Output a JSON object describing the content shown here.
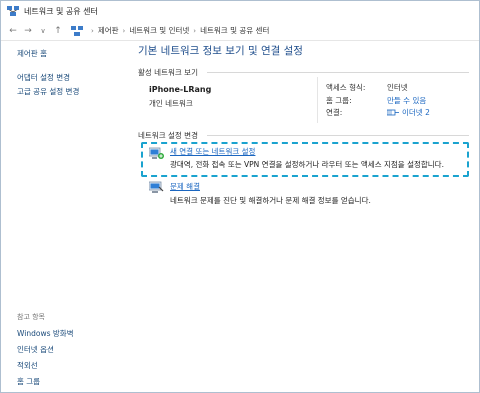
{
  "window": {
    "title": "네트워크 및 공유 센터"
  },
  "addressbar": {
    "crumbs": [
      "제어판",
      "네트워크 및 인터넷",
      "네트워크 및 공유 센터"
    ]
  },
  "sidebar": {
    "home": "제어판 홈",
    "adapter": "어댑터 설정 변경",
    "sharing": "고급 공유 설정 변경"
  },
  "seealso": {
    "heading": "참고 항목",
    "items": [
      "Windows 방화벽",
      "인터넷 옵션",
      "적외선",
      "홈 그룹"
    ]
  },
  "main": {
    "title": "기본 네트워크 정보 보기 및 연결 설정",
    "active_section": "활성 네트워크 보기",
    "network": {
      "name": "iPhone-LRang",
      "type": "개인 네트워크"
    },
    "details": {
      "access_label": "액세스 형식:",
      "access_value": "인터넷",
      "homegroup_label": "홈 그룹:",
      "homegroup_value": "만들 수 있음",
      "connection_label": "연결:",
      "connection_value": "이더넷 2"
    },
    "change_section": "네트워크 설정 변경",
    "tasks": [
      {
        "link": "새 연결 또는 네트워크 설정",
        "desc": "광대역, 전화 접속 또는 VPN 연결을 설정하거나 라우터 또는 액세스 지점을 설정합니다."
      },
      {
        "link": "문제 해결",
        "desc": "네트워크 문제를 진단 및 해결하거나 문제 해결 정보를 얻습니다."
      }
    ]
  },
  "colors": {
    "accent": "#1a66c0",
    "title": "#1f4e8c",
    "highlight": "#1aa3cf"
  }
}
